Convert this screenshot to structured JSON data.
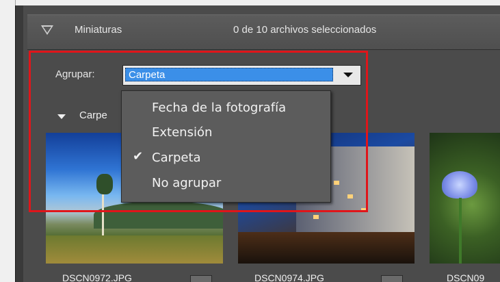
{
  "header": {
    "title": "Miniaturas",
    "selection_count": "0 de 10 archivos seleccionados"
  },
  "group_by": {
    "label": "Agrupar:",
    "selected_value": "Carpeta",
    "options": [
      {
        "label": "Fecha de la fotografía",
        "checked": false
      },
      {
        "label": "Extensión",
        "checked": false
      },
      {
        "label": "Carpeta",
        "checked": true
      },
      {
        "label": "No agrupar",
        "checked": false
      }
    ]
  },
  "group_header": {
    "label": "Carpe"
  },
  "thumbnails": [
    {
      "caption": "DSCN0972.JPG"
    },
    {
      "caption": "DSCN0974.JPG"
    },
    {
      "caption": "DSCN09"
    }
  ],
  "colors": {
    "panel_bg": "#4b4b4b",
    "selection_blue": "#3b8fe8",
    "highlight_red": "#e0151a",
    "menu_bg": "#5c5c5c"
  }
}
